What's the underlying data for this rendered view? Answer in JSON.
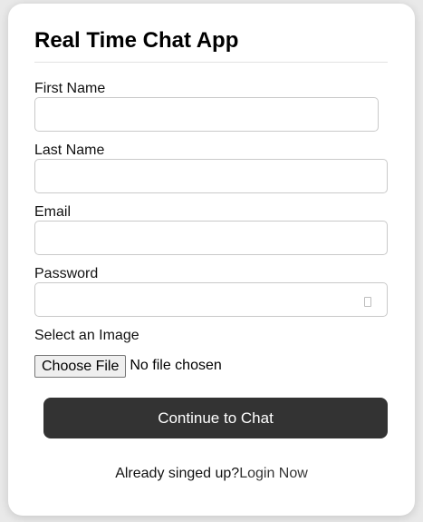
{
  "form": {
    "title": "Real Time Chat App",
    "first_name": {
      "label": "First Name",
      "value": "",
      "placeholder": ""
    },
    "last_name": {
      "label": "Last Name",
      "value": "",
      "placeholder": ""
    },
    "email": {
      "label": "Email",
      "value": "",
      "placeholder": ""
    },
    "password": {
      "label": "Password",
      "value": "",
      "placeholder": ""
    },
    "image": {
      "label": "Select an Image",
      "button_label": "Choose File",
      "status": "No file chosen"
    },
    "submit_label": "Continue to Chat"
  },
  "footer": {
    "text": "Already singed up?",
    "link_label": "Login Now"
  },
  "icons": {
    "password_toggle": "eye-icon"
  },
  "colors": {
    "button_bg": "#333333",
    "button_text": "#ffffff",
    "background": "#e9e9e9",
    "card": "#ffffff"
  }
}
